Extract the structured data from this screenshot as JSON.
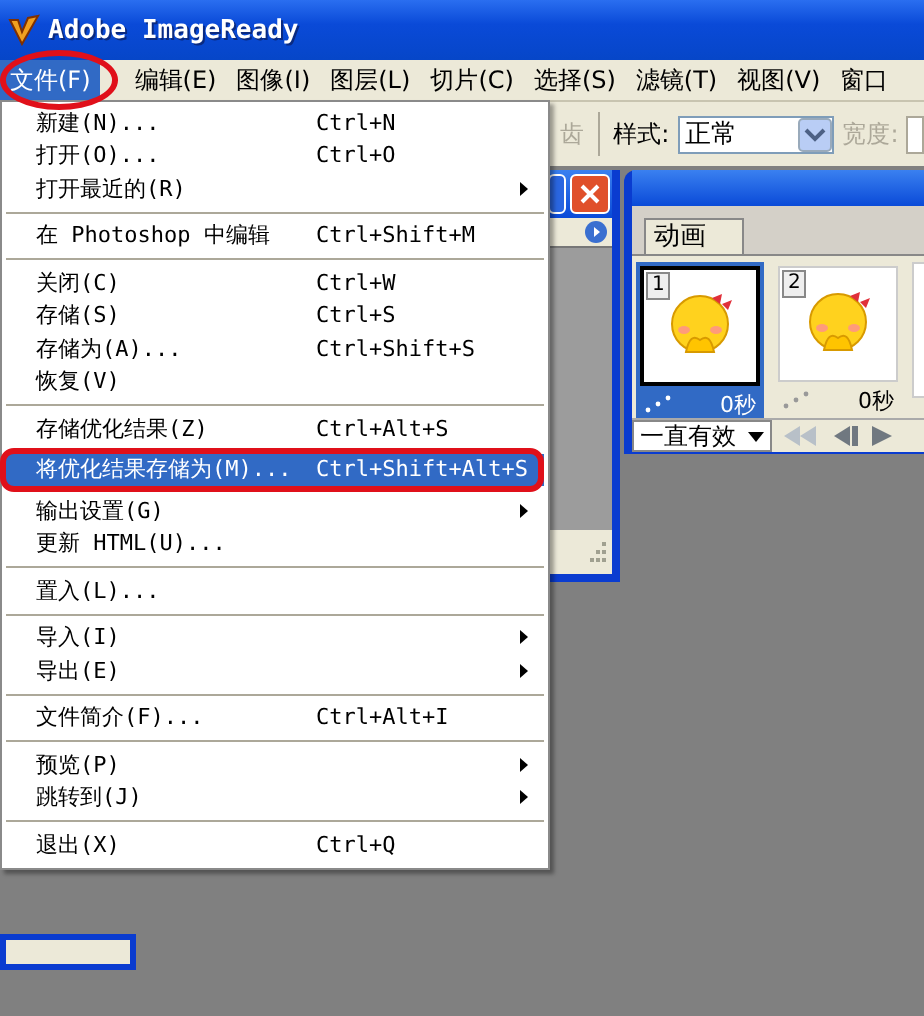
{
  "window": {
    "title": "Adobe ImageReady"
  },
  "menubar": [
    {
      "label": "文件(F)",
      "selected": true,
      "circled": true
    },
    {
      "label": "编辑(E)",
      "selected": false,
      "circled": false
    },
    {
      "label": "图像(I)",
      "selected": false,
      "circled": false
    },
    {
      "label": "图层(L)",
      "selected": false,
      "circled": false
    },
    {
      "label": "切片(C)",
      "selected": false,
      "circled": false
    },
    {
      "label": "选择(S)",
      "selected": false,
      "circled": false
    },
    {
      "label": "滤镜(T)",
      "selected": false,
      "circled": false
    },
    {
      "label": "视图(V)",
      "selected": false,
      "circled": false
    },
    {
      "label": "窗口",
      "selected": false,
      "circled": false
    }
  ],
  "options_bar": {
    "partial_label": "齿",
    "style_label": "样式:",
    "style_value": "正常",
    "width_label": "宽度:"
  },
  "file_menu": [
    {
      "kind": "item",
      "label": "新建(N)...",
      "shortcut": "Ctrl+N",
      "submenu": false,
      "selected": false,
      "circled": false
    },
    {
      "kind": "item",
      "label": "打开(O)...",
      "shortcut": "Ctrl+O",
      "submenu": false,
      "selected": false,
      "circled": false
    },
    {
      "kind": "item",
      "label": "打开最近的(R)",
      "submenu": true,
      "selected": false,
      "circled": false
    },
    {
      "kind": "separator"
    },
    {
      "kind": "item",
      "label": "在 Photoshop 中编辑",
      "shortcut": "Ctrl+Shift+M",
      "submenu": false,
      "selected": false,
      "circled": false
    },
    {
      "kind": "separator"
    },
    {
      "kind": "item",
      "label": "关闭(C)",
      "shortcut": "Ctrl+W",
      "submenu": false,
      "selected": false,
      "circled": false
    },
    {
      "kind": "item",
      "label": "存储(S)",
      "shortcut": "Ctrl+S",
      "submenu": false,
      "selected": false,
      "circled": false
    },
    {
      "kind": "item",
      "label": "存储为(A)...",
      "shortcut": "Ctrl+Shift+S",
      "submenu": false,
      "selected": false,
      "circled": false
    },
    {
      "kind": "item",
      "label": "恢复(V)",
      "submenu": false,
      "selected": false,
      "circled": false
    },
    {
      "kind": "separator"
    },
    {
      "kind": "item",
      "label": "存储优化结果(Z)",
      "shortcut": "Ctrl+Alt+S",
      "submenu": false,
      "selected": false,
      "circled": false
    },
    {
      "kind": "item",
      "label": "将优化结果存储为(M)...",
      "shortcut": "Ctrl+Shift+Alt+S",
      "submenu": false,
      "selected": true,
      "circled": true
    },
    {
      "kind": "item",
      "label": "输出设置(G)",
      "submenu": true,
      "selected": false,
      "circled": false
    },
    {
      "kind": "item",
      "label": "更新 HTML(U)...",
      "submenu": false,
      "selected": false,
      "circled": false
    },
    {
      "kind": "separator"
    },
    {
      "kind": "item",
      "label": "置入(L)...",
      "submenu": false,
      "selected": false,
      "circled": false
    },
    {
      "kind": "separator"
    },
    {
      "kind": "item",
      "label": "导入(I)",
      "submenu": true,
      "selected": false,
      "circled": false
    },
    {
      "kind": "item",
      "label": "导出(E)",
      "submenu": true,
      "selected": false,
      "circled": false
    },
    {
      "kind": "separator"
    },
    {
      "kind": "item",
      "label": "文件简介(F)...",
      "shortcut": "Ctrl+Alt+I",
      "submenu": false,
      "selected": false,
      "circled": false
    },
    {
      "kind": "separator"
    },
    {
      "kind": "item",
      "label": "预览(P)",
      "submenu": true,
      "selected": false,
      "circled": false
    },
    {
      "kind": "item",
      "label": "跳转到(J)",
      "submenu": true,
      "selected": false,
      "circled": false
    },
    {
      "kind": "separator"
    },
    {
      "kind": "item",
      "label": "退出(X)",
      "shortcut": "Ctrl+Q",
      "submenu": false,
      "selected": false,
      "circled": false
    }
  ],
  "animation_panel": {
    "tab": "动画",
    "loop": "一直有效",
    "frames": [
      {
        "number": "1",
        "delay": "0秒",
        "selected": true
      },
      {
        "number": "2",
        "delay": "0秒",
        "selected": false
      }
    ]
  }
}
